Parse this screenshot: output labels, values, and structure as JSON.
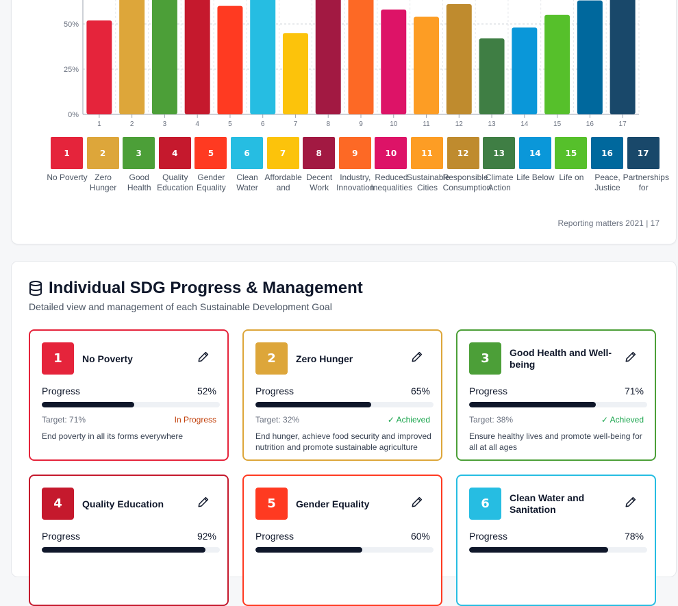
{
  "chart_data": {
    "type": "bar",
    "categories": [
      "1",
      "2",
      "3",
      "4",
      "5",
      "6",
      "7",
      "8",
      "9",
      "10",
      "11",
      "12",
      "13",
      "14",
      "15",
      "16",
      "17"
    ],
    "values": [
      52,
      65,
      71,
      92,
      60,
      78,
      45,
      70,
      68,
      58,
      54,
      61,
      42,
      48,
      55,
      63,
      73
    ],
    "colors": [
      "#e5243b",
      "#dda63a",
      "#4c9f38",
      "#c5192d",
      "#ff3a21",
      "#26bde2",
      "#fcc30b",
      "#a21942",
      "#fd6925",
      "#dd1367",
      "#fd9d24",
      "#bf8b2e",
      "#3f7e44",
      "#0a97d9",
      "#56c02b",
      "#00689d",
      "#19486a"
    ],
    "yticks": [
      "0%",
      "25%",
      "50%"
    ],
    "ylim": [
      0,
      100
    ],
    "grid": true
  },
  "legend": [
    {
      "num": "1",
      "label": "No Poverty",
      "color": "#e5243b"
    },
    {
      "num": "2",
      "label": "Zero Hunger",
      "color": "#dda63a"
    },
    {
      "num": "3",
      "label": "Good Health",
      "color": "#4c9f38"
    },
    {
      "num": "4",
      "label": "Quality Education",
      "color": "#c5192d"
    },
    {
      "num": "5",
      "label": "Gender Equality",
      "color": "#ff3a21"
    },
    {
      "num": "6",
      "label": "Clean Water",
      "color": "#26bde2"
    },
    {
      "num": "7",
      "label": "Affordable and",
      "color": "#fcc30b"
    },
    {
      "num": "8",
      "label": "Decent Work",
      "color": "#a21942"
    },
    {
      "num": "9",
      "label": "Industry, Innovation",
      "color": "#fd6925"
    },
    {
      "num": "10",
      "label": "Reduced Inequalities",
      "color": "#dd1367"
    },
    {
      "num": "11",
      "label": "Sustainable Cities",
      "color": "#fd9d24"
    },
    {
      "num": "12",
      "label": "Responsible Consumption",
      "color": "#bf8b2e"
    },
    {
      "num": "13",
      "label": "Climate Action",
      "color": "#3f7e44"
    },
    {
      "num": "14",
      "label": "Life Below",
      "color": "#0a97d9"
    },
    {
      "num": "15",
      "label": "Life on",
      "color": "#56c02b"
    },
    {
      "num": "16",
      "label": "Peace, Justice",
      "color": "#00689d"
    },
    {
      "num": "17",
      "label": "Partnerships for",
      "color": "#19486a"
    }
  ],
  "footnote": "Reporting matters 2021 | 17",
  "section": {
    "title": "Individual SDG Progress & Management",
    "subtitle": "Detailed view and management of each Sustainable Development Goal"
  },
  "cards": [
    {
      "num": "1",
      "name": "No Poverty",
      "color": "#e5243b",
      "progress_label": "Progress",
      "progress": 52,
      "pct": "52%",
      "target": "Target: 71%",
      "status": "In Progress",
      "status_color": "#c2410c",
      "desc": "End poverty in all its forms everywhere"
    },
    {
      "num": "2",
      "name": "Zero Hunger",
      "color": "#dda63a",
      "progress_label": "Progress",
      "progress": 65,
      "pct": "65%",
      "target": "Target: 32%",
      "status": "✓ Achieved",
      "status_color": "#16a34a",
      "desc": "End hunger, achieve food security and improved nutrition and promote sustainable agriculture"
    },
    {
      "num": "3",
      "name": "Good Health and Well-being",
      "color": "#4c9f38",
      "progress_label": "Progress",
      "progress": 71,
      "pct": "71%",
      "target": "Target: 38%",
      "status": "✓ Achieved",
      "status_color": "#16a34a",
      "desc": "Ensure healthy lives and promote well-being for all at all ages"
    },
    {
      "num": "4",
      "name": "Quality Education",
      "color": "#c5192d",
      "progress_label": "Progress",
      "progress": 92,
      "pct": "92%",
      "target": "",
      "status": "",
      "status_color": "#16a34a",
      "desc": ""
    },
    {
      "num": "5",
      "name": "Gender Equality",
      "color": "#ff3a21",
      "progress_label": "Progress",
      "progress": 60,
      "pct": "60%",
      "target": "",
      "status": "",
      "status_color": "#16a34a",
      "desc": ""
    },
    {
      "num": "6",
      "name": "Clean Water and Sanitation",
      "color": "#26bde2",
      "progress_label": "Progress",
      "progress": 78,
      "pct": "78%",
      "target": "",
      "status": "",
      "status_color": "#16a34a",
      "desc": ""
    }
  ]
}
